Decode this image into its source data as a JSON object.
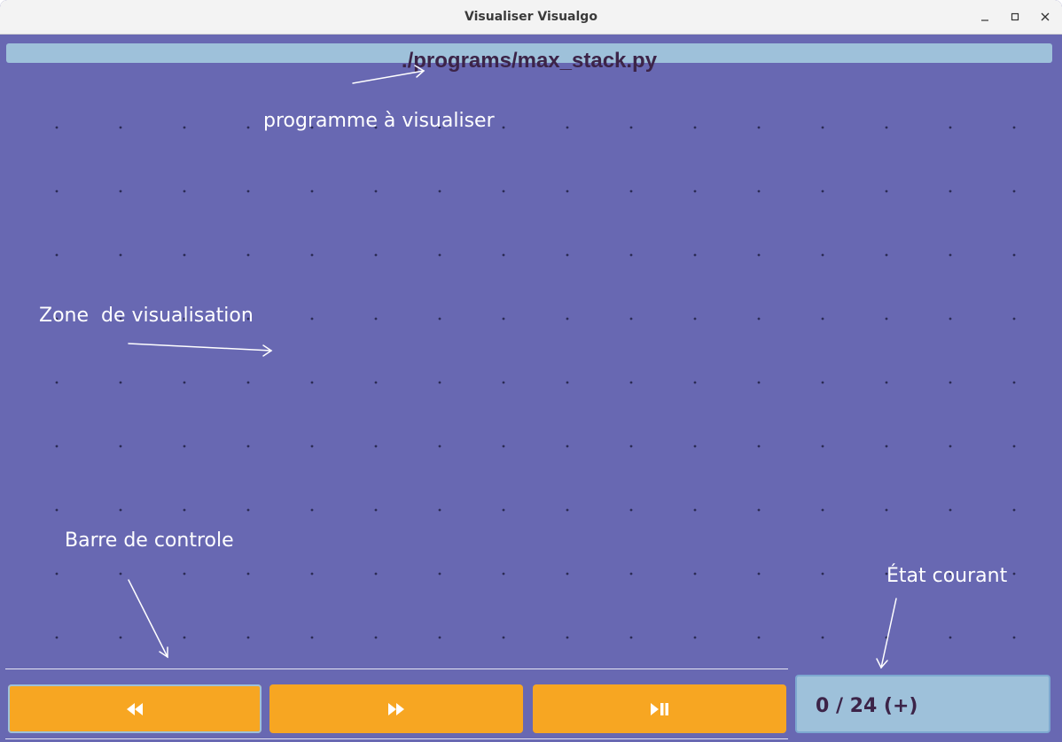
{
  "window": {
    "title": "Visualiser Visualgo",
    "controls": [
      "minimize",
      "maximize",
      "close"
    ]
  },
  "program_path": "./programs/max_stack.py",
  "annotations": {
    "program": "programme à visualiser",
    "zone": "Zone  de visualisation",
    "controls": "Barre de controle",
    "state": "État courant"
  },
  "controls": {
    "rewind_icon": "rewind-icon",
    "forward_icon": "fast-forward-icon",
    "playpause_icon": "play-pause-icon"
  },
  "state": {
    "text": "0 / 24 (+)"
  },
  "colors": {
    "canvas": "#6868b2",
    "path_bar": "#9ec1da",
    "button": "#f7a622",
    "state_box": "#9ec1da",
    "dark_text": "#3c2448",
    "dots": "#2b2b55",
    "annotation": "#ffffff"
  }
}
